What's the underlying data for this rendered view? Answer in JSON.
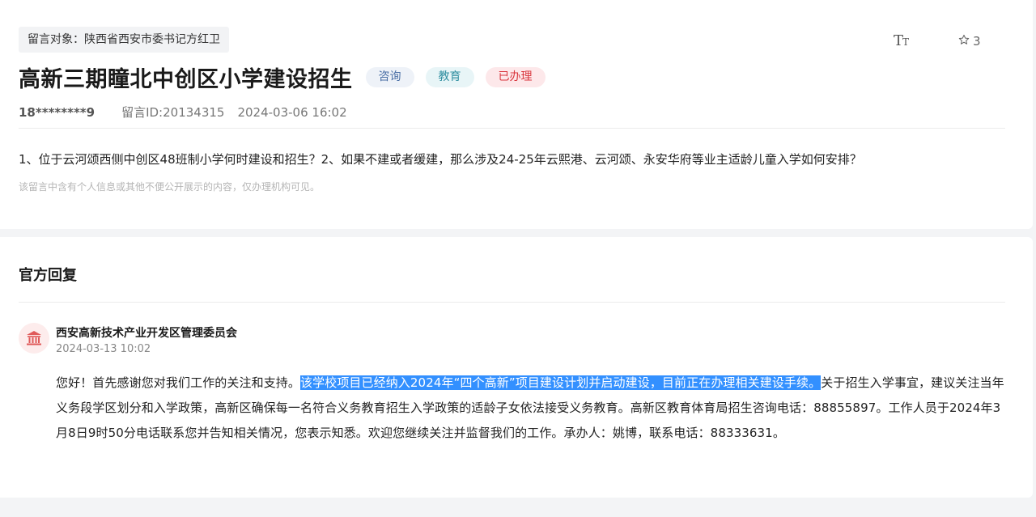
{
  "message": {
    "target_label": "留言对象：陕西省西安市委书记方红卫",
    "title": "高新三期瞳北中创区小学建设招生",
    "tags": [
      "咨询",
      "教育",
      "已办理"
    ],
    "user": "18********9",
    "message_id": "留言ID:20134315",
    "datetime": "2024-03-06 16:02",
    "content": "1、位于云河颂西侧中创区48班制小学何时建设和招生？2、如果不建或者缓建，那么涉及24-25年云熙港、云河颂、永安华府等业主适龄儿童入学如何安排？",
    "privacy_note": "该留言中含有个人信息或其他不便公开展示的内容，仅办理机构可见。"
  },
  "toolbar": {
    "font_size_icon": "font-size-icon",
    "favorite_icon": "star-outline-icon",
    "favorite_count": "3"
  },
  "reply": {
    "heading": "官方回复",
    "org_icon": "government-building-icon",
    "org_name": "西安高新技术产业开发区管理委员会",
    "time": "2024-03-13 10:02",
    "body_before": "您好！首先感谢您对我们工作的关注和支持。",
    "body_selected": "该学校项目已经纳入2024年“四个高新”项目建设计划并启动建设，目前正在办理相关建设手续。",
    "body_after": "关于招生入学事宜，建议关注当年义务段学区划分和入学政策，高新区确保每一名符合义务教育招生入学政策的适龄子女依法接受义务教育。高新区教育体育局招生咨询电话：88855897。工作人员于2024年3月8日9时50分电话联系您并告知相关情况，您表示知悉。欢迎您继续关注并监督我们的工作。承办人：姚博，联系电话：88333631。"
  },
  "colors": {
    "selection": "#3390ff",
    "tag_consult": "#4a6fa5",
    "tag_edu": "#2f8ea0",
    "tag_done": "#d9363e"
  }
}
